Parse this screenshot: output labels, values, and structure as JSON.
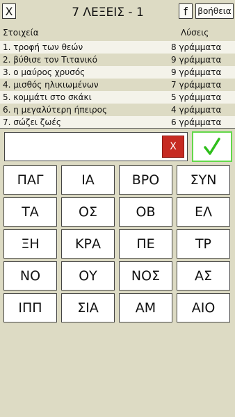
{
  "header": {
    "close_label": "X",
    "title": "7 ΛΕΞΕΙΣ - 1",
    "fb_label": "f",
    "help_label": "βοήθεια"
  },
  "columns": {
    "clues": "Στοιχεία",
    "solutions": "Λύσεις"
  },
  "clues": [
    {
      "text": "1. τροφή των θεών",
      "letters": "8 γράμματα"
    },
    {
      "text": "2. βύθισε τον Τιτανικό",
      "letters": "9 γράμματα"
    },
    {
      "text": "3. ο μαύρος χρυσός",
      "letters": "9 γράμματα"
    },
    {
      "text": "4. μισθός ηλικιωμένων",
      "letters": "7 γράμματα"
    },
    {
      "text": "5. κομμάτι στο σκάκι",
      "letters": "5 γράμματα"
    },
    {
      "text": "6. η μεγαλύτερη ήπειρος",
      "letters": "4 γράμματα"
    },
    {
      "text": "7. σώζει ζωές",
      "letters": "6 γράμματα"
    }
  ],
  "answer": {
    "value": "",
    "clear_label": "X",
    "submit_icon": "check-icon",
    "submit_color": "#2fbf1c"
  },
  "tiles": [
    "ΠΑΓ",
    "ΙΑ",
    "ΒΡΟ",
    "ΣΥΝ",
    "ΤΑ",
    "ΟΣ",
    "ΟΒ",
    "ΕΛ",
    "ΞΗ",
    "ΚΡΑ",
    "ΠΕ",
    "ΤΡ",
    "ΝΟ",
    "ΟΥ",
    "ΝΟΣ",
    "ΑΣ",
    "ΙΠΠ",
    "ΣΙΑ",
    "ΑΜ",
    "ΑΙΟ"
  ]
}
